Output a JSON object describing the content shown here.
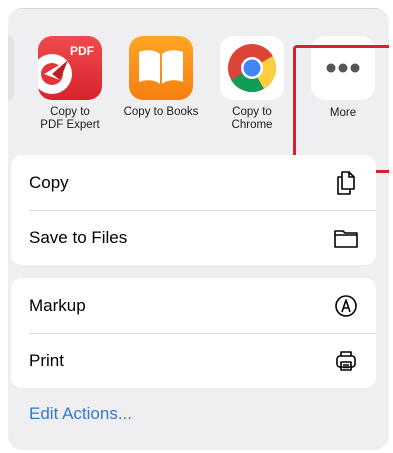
{
  "apps": [
    {
      "label_line1": "Copy to",
      "label_line2": "PDF Expert",
      "icon": "pdf-expert-icon"
    },
    {
      "label": "Copy to Books",
      "icon": "books-icon"
    },
    {
      "label_line1": "Copy to",
      "label_line2": "Chrome",
      "icon": "chrome-icon"
    },
    {
      "label": "More",
      "icon": "more-icon"
    }
  ],
  "pdf_badge": "PDF",
  "actions_group1": [
    {
      "label": "Copy",
      "icon": "copy-icon"
    },
    {
      "label": "Save to Files",
      "icon": "folder-icon"
    }
  ],
  "actions_group2": [
    {
      "label": "Markup",
      "icon": "markup-icon"
    },
    {
      "label": "Print",
      "icon": "printer-icon"
    }
  ],
  "edit_actions": "Edit Actions...",
  "colors": {
    "highlight": "#d2242f",
    "link": "#2f7ad6",
    "sheet_bg": "#efeff1"
  }
}
